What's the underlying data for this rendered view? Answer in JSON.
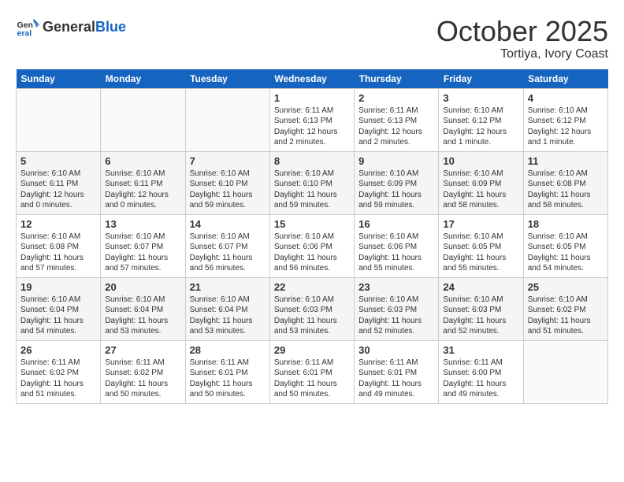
{
  "header": {
    "logo_line1": "General",
    "logo_line2": "Blue",
    "month": "October 2025",
    "location": "Tortiya, Ivory Coast"
  },
  "weekdays": [
    "Sunday",
    "Monday",
    "Tuesday",
    "Wednesday",
    "Thursday",
    "Friday",
    "Saturday"
  ],
  "weeks": [
    [
      {
        "day": "",
        "info": ""
      },
      {
        "day": "",
        "info": ""
      },
      {
        "day": "",
        "info": ""
      },
      {
        "day": "1",
        "info": "Sunrise: 6:11 AM\nSunset: 6:13 PM\nDaylight: 12 hours and 2 minutes."
      },
      {
        "day": "2",
        "info": "Sunrise: 6:11 AM\nSunset: 6:13 PM\nDaylight: 12 hours and 2 minutes."
      },
      {
        "day": "3",
        "info": "Sunrise: 6:10 AM\nSunset: 6:12 PM\nDaylight: 12 hours and 1 minute."
      },
      {
        "day": "4",
        "info": "Sunrise: 6:10 AM\nSunset: 6:12 PM\nDaylight: 12 hours and 1 minute."
      }
    ],
    [
      {
        "day": "5",
        "info": "Sunrise: 6:10 AM\nSunset: 6:11 PM\nDaylight: 12 hours and 0 minutes."
      },
      {
        "day": "6",
        "info": "Sunrise: 6:10 AM\nSunset: 6:11 PM\nDaylight: 12 hours and 0 minutes."
      },
      {
        "day": "7",
        "info": "Sunrise: 6:10 AM\nSunset: 6:10 PM\nDaylight: 11 hours and 59 minutes."
      },
      {
        "day": "8",
        "info": "Sunrise: 6:10 AM\nSunset: 6:10 PM\nDaylight: 11 hours and 59 minutes."
      },
      {
        "day": "9",
        "info": "Sunrise: 6:10 AM\nSunset: 6:09 PM\nDaylight: 11 hours and 59 minutes."
      },
      {
        "day": "10",
        "info": "Sunrise: 6:10 AM\nSunset: 6:09 PM\nDaylight: 11 hours and 58 minutes."
      },
      {
        "day": "11",
        "info": "Sunrise: 6:10 AM\nSunset: 6:08 PM\nDaylight: 11 hours and 58 minutes."
      }
    ],
    [
      {
        "day": "12",
        "info": "Sunrise: 6:10 AM\nSunset: 6:08 PM\nDaylight: 11 hours and 57 minutes."
      },
      {
        "day": "13",
        "info": "Sunrise: 6:10 AM\nSunset: 6:07 PM\nDaylight: 11 hours and 57 minutes."
      },
      {
        "day": "14",
        "info": "Sunrise: 6:10 AM\nSunset: 6:07 PM\nDaylight: 11 hours and 56 minutes."
      },
      {
        "day": "15",
        "info": "Sunrise: 6:10 AM\nSunset: 6:06 PM\nDaylight: 11 hours and 56 minutes."
      },
      {
        "day": "16",
        "info": "Sunrise: 6:10 AM\nSunset: 6:06 PM\nDaylight: 11 hours and 55 minutes."
      },
      {
        "day": "17",
        "info": "Sunrise: 6:10 AM\nSunset: 6:05 PM\nDaylight: 11 hours and 55 minutes."
      },
      {
        "day": "18",
        "info": "Sunrise: 6:10 AM\nSunset: 6:05 PM\nDaylight: 11 hours and 54 minutes."
      }
    ],
    [
      {
        "day": "19",
        "info": "Sunrise: 6:10 AM\nSunset: 6:04 PM\nDaylight: 11 hours and 54 minutes."
      },
      {
        "day": "20",
        "info": "Sunrise: 6:10 AM\nSunset: 6:04 PM\nDaylight: 11 hours and 53 minutes."
      },
      {
        "day": "21",
        "info": "Sunrise: 6:10 AM\nSunset: 6:04 PM\nDaylight: 11 hours and 53 minutes."
      },
      {
        "day": "22",
        "info": "Sunrise: 6:10 AM\nSunset: 6:03 PM\nDaylight: 11 hours and 53 minutes."
      },
      {
        "day": "23",
        "info": "Sunrise: 6:10 AM\nSunset: 6:03 PM\nDaylight: 11 hours and 52 minutes."
      },
      {
        "day": "24",
        "info": "Sunrise: 6:10 AM\nSunset: 6:03 PM\nDaylight: 11 hours and 52 minutes."
      },
      {
        "day": "25",
        "info": "Sunrise: 6:10 AM\nSunset: 6:02 PM\nDaylight: 11 hours and 51 minutes."
      }
    ],
    [
      {
        "day": "26",
        "info": "Sunrise: 6:11 AM\nSunset: 6:02 PM\nDaylight: 11 hours and 51 minutes."
      },
      {
        "day": "27",
        "info": "Sunrise: 6:11 AM\nSunset: 6:02 PM\nDaylight: 11 hours and 50 minutes."
      },
      {
        "day": "28",
        "info": "Sunrise: 6:11 AM\nSunset: 6:01 PM\nDaylight: 11 hours and 50 minutes."
      },
      {
        "day": "29",
        "info": "Sunrise: 6:11 AM\nSunset: 6:01 PM\nDaylight: 11 hours and 50 minutes."
      },
      {
        "day": "30",
        "info": "Sunrise: 6:11 AM\nSunset: 6:01 PM\nDaylight: 11 hours and 49 minutes."
      },
      {
        "day": "31",
        "info": "Sunrise: 6:11 AM\nSunset: 6:00 PM\nDaylight: 11 hours and 49 minutes."
      },
      {
        "day": "",
        "info": ""
      }
    ]
  ]
}
